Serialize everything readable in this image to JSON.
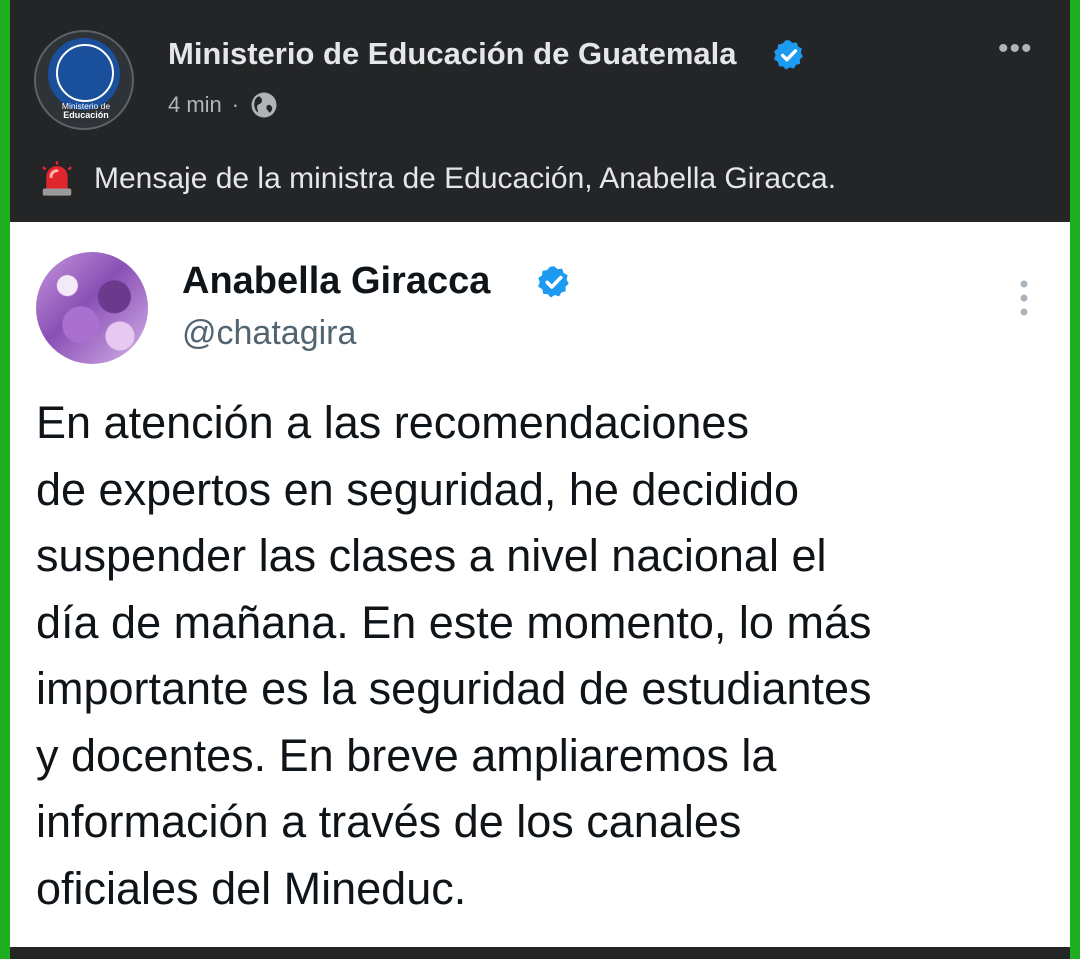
{
  "post": {
    "page_name": "Ministerio de Educación de Guatemala",
    "avatar_caption_line1": "Ministerio de",
    "avatar_caption_line2": "Educación",
    "time": "4 min",
    "separator": "·",
    "caption": "Mensaje de la ministra de Educación, Anabella Giracca.",
    "more_icon": "more-horizontal-icon",
    "privacy_icon": "globe-icon",
    "caption_icon": "siren-icon"
  },
  "tweet": {
    "name": "Anabella Giracca",
    "handle": "@chatagira",
    "verified_icon": "verified-badge-icon",
    "more_icon": "more-vertical-icon",
    "lines": [
      "En atención a las recomendaciones",
      "de expertos en seguridad, he decidido",
      "suspender las clases a nivel nacional el",
      "día de mañana. En este momento, lo más",
      "importante es la seguridad de estudiantes",
      "y docentes. En breve ampliaremos la",
      "información a través de los canales",
      "oficiales del Mineduc."
    ]
  },
  "colors": {
    "frame_border": "#1fae1f",
    "fb_background": "#242526",
    "verified_blue": "#1d9bf0",
    "tweet_background": "#ffffff"
  }
}
